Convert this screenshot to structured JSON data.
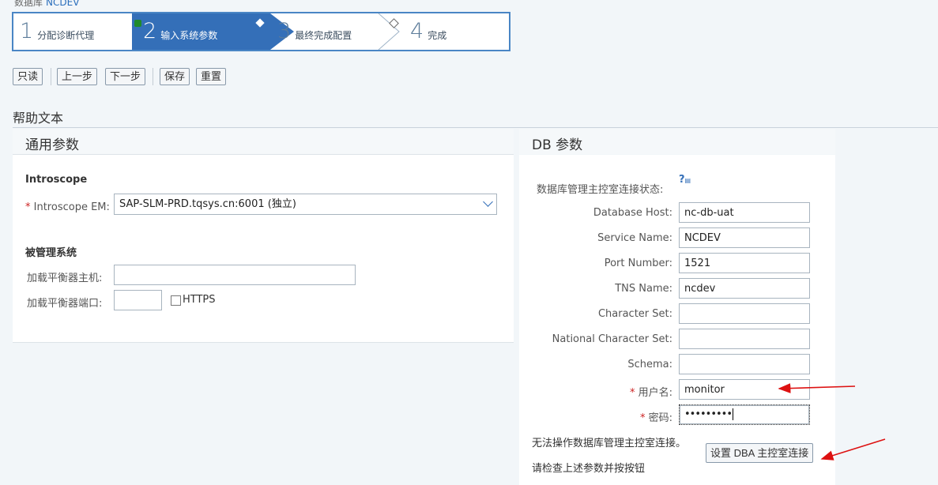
{
  "header": {
    "db_label": "数据库",
    "db_value": "NCDEV"
  },
  "wizard": {
    "steps": [
      {
        "num": "1",
        "label": "分配诊断代理"
      },
      {
        "num": "2",
        "label": "输入系统参数"
      },
      {
        "num": "3",
        "label": "最终完成配置"
      },
      {
        "num": "4",
        "label": "完成"
      }
    ],
    "active_color": "#346fb8",
    "done_marker_color": "#1f8a2b"
  },
  "toolbar": {
    "readonly": "只读",
    "prev": "上一步",
    "next": "下一步",
    "save": "保存",
    "reset": "重置"
  },
  "help": {
    "title": "帮助文本"
  },
  "general": {
    "title": "通用参数",
    "introscope_title": "Introscope",
    "em_label": "Introscope EM:",
    "em_value": "SAP-SLM-PRD.tqsys.cn:6001 (独立)",
    "managed_title": "被管理系统",
    "lb_host_label": "加载平衡器主机:",
    "lb_host_value": "",
    "lb_port_label": "加载平衡器端口:",
    "lb_port_value": "",
    "https_label": "HTTPS"
  },
  "db": {
    "title": "DB 参数",
    "status_label": "数据库管理主控室连接状态:",
    "fields": [
      {
        "label": "Database Host:",
        "value": "nc-db-uat",
        "required": false
      },
      {
        "label": "Service Name:",
        "value": "NCDEV",
        "required": false
      },
      {
        "label": "Port Number:",
        "value": "1521",
        "required": false
      },
      {
        "label": "TNS Name:",
        "value": "ncdev",
        "required": false
      },
      {
        "label": "Character Set:",
        "value": "",
        "required": false
      },
      {
        "label": "National Character Set:",
        "value": "",
        "required": false
      },
      {
        "label": "Schema:",
        "value": "",
        "required": false
      },
      {
        "label": "用户名:",
        "value": "monitor",
        "required": true
      },
      {
        "label": "密码:",
        "value": "•••••••••",
        "required": true
      }
    ],
    "msg1": "无法操作数据库管理主控室连接。",
    "msg2": "请检查上述参数并按按钮",
    "dba_button": "设置 DBA 主控室连接"
  },
  "annotation_color": "#dd1111"
}
